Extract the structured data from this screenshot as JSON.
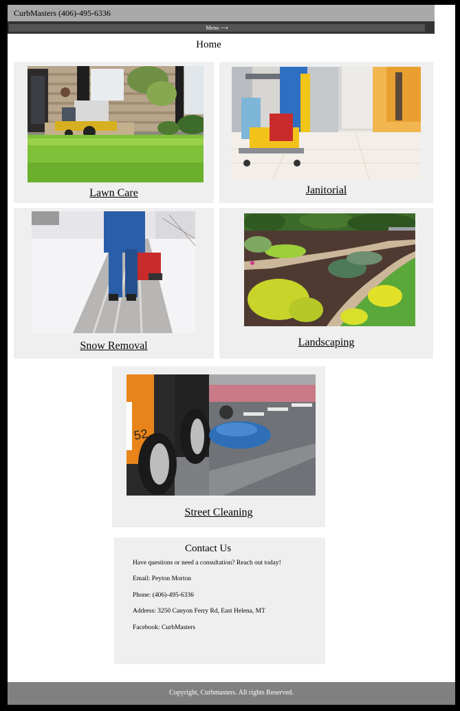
{
  "header": {
    "brand": "CurbMasters (406)-495-6336",
    "menu_label": "Menu ⟶"
  },
  "page_title": "Home",
  "services": [
    {
      "label": "Lawn Care",
      "image": "lawn-care-photo"
    },
    {
      "label": "Janitorial",
      "image": "janitorial-photo"
    },
    {
      "label": "Snow Removal",
      "image": "snow-removal-photo"
    },
    {
      "label": "Landscaping",
      "image": "landscaping-photo"
    },
    {
      "label": "Street Cleaning",
      "image": "street-cleaning-photo"
    }
  ],
  "contact": {
    "title": "Contact Us",
    "intro": "Have questions or need a consultation? Reach out today!",
    "email": "Email: Peyton Morton",
    "phone": "Phone: (406)-495-6336",
    "address": "Address: 3250 Canyon Ferry Rd, East Helena, MT",
    "facebook": "Facebook: CurbMasters"
  },
  "footer": {
    "copyright": "Copyright, Curbmasters. All rights Reserved."
  }
}
